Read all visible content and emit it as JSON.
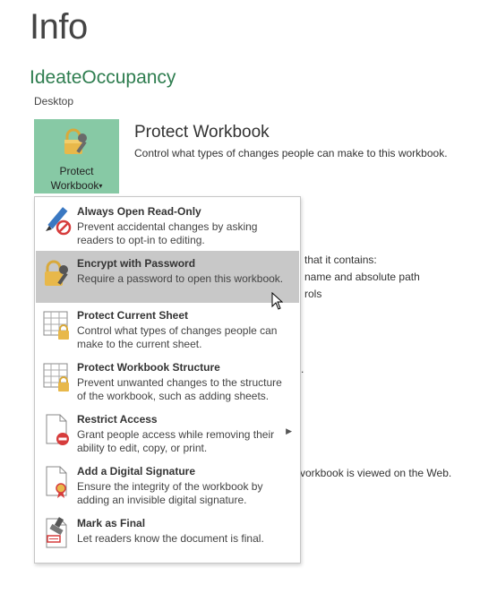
{
  "page": {
    "title": "Info",
    "file_name": "IdeateOccupancy",
    "file_location": "Desktop"
  },
  "protect_button": {
    "line1": "Protect",
    "line2": "Workbook",
    "arrow": "▾"
  },
  "section": {
    "heading": "Protect Workbook",
    "description": "Control what types of changes people can make to this workbook."
  },
  "background_text": {
    "line1": "that it contains:",
    "line2": "name and absolute path",
    "line3": "rols",
    "line4": ".",
    "line5": "vorkbook is viewed on the Web."
  },
  "menu": {
    "items": [
      {
        "title": "Always Open Read-Only",
        "description": "Prevent accidental changes by asking readers to opt-in to editing.",
        "icon": "pencil-no-icon"
      },
      {
        "title": "Encrypt with Password",
        "description": "Require a password to open this workbook.",
        "icon": "lock-key-icon"
      },
      {
        "title": "Protect Current Sheet",
        "description": "Control what types of changes people can make to the current sheet.",
        "icon": "sheet-lock-icon"
      },
      {
        "title": "Protect Workbook Structure",
        "description": "Prevent unwanted changes to the structure of the workbook, such as adding sheets.",
        "icon": "workbook-lock-icon"
      },
      {
        "title": "Restrict Access",
        "description": "Grant people access while removing their ability to edit, copy, or print.",
        "icon": "document-restrict-icon",
        "has_submenu": true
      },
      {
        "title": "Add a Digital Signature",
        "description": "Ensure the integrity of the workbook by adding an invisible digital signature.",
        "icon": "document-ribbon-icon"
      },
      {
        "title": "Mark as Final",
        "description": "Let readers know the document is final.",
        "icon": "stamp-icon"
      }
    ],
    "submenu_arrow": "▶",
    "highlighted_index": 1
  }
}
